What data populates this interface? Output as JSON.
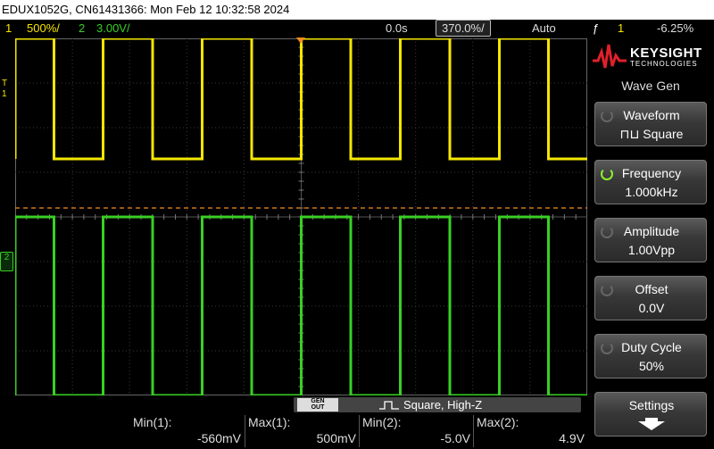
{
  "window": {
    "title": "EDUX1052G, CN61431366: Mon Feb 12 10:32:58 2024"
  },
  "status": {
    "ch1_num": "1",
    "ch1_scale": "500%/",
    "ch2_num": "2",
    "ch2_scale": "3.00V/",
    "time_delay": "0.0s",
    "time_scale": "370.0%/",
    "trigger_mode": "Auto",
    "trigger_icon": "ƒ",
    "trigger_source": "1",
    "trigger_level": "-6.25%"
  },
  "markers": {
    "ch1": "1",
    "ch2": "2",
    "trig": "T"
  },
  "brand": {
    "name": "KEYSIGHT",
    "sub": "TECHNOLOGIES"
  },
  "menu": {
    "title": "Wave Gen",
    "softkeys": [
      {
        "label": "Waveform",
        "value": "⊓⊔ Square"
      },
      {
        "label": "Frequency",
        "value": "1.000kHz"
      },
      {
        "label": "Amplitude",
        "value": "1.00Vpp"
      },
      {
        "label": "Offset",
        "value": "0.0V"
      },
      {
        "label": "Duty Cycle",
        "value": "50%"
      },
      {
        "label": "Settings",
        "value": ""
      }
    ]
  },
  "gen_bar": {
    "out_label_1": "GEN",
    "out_label_2": "OUT",
    "description": "Square, High-Z"
  },
  "measurements": [
    {
      "label": "Min(1):",
      "value": "-560mV"
    },
    {
      "label": "Max(1):",
      "value": "500mV"
    },
    {
      "label": "Min(2):",
      "value": "-5.0V"
    },
    {
      "label": "Max(2):",
      "value": "4.9V"
    }
  ],
  "colors": {
    "ch1": "#f5e600",
    "ch2": "#39d024",
    "trigger": "#f28c1c",
    "grid": "#3a3a3a"
  },
  "traces": {
    "period_ms": 1.0,
    "duty_cycle": 0.5,
    "ch1_high_div": 4.0,
    "ch1_low_div": 1.3,
    "ch2_high_div": 0.0,
    "ch2_low_div": -4.0,
    "trigger_div": 0.2
  }
}
